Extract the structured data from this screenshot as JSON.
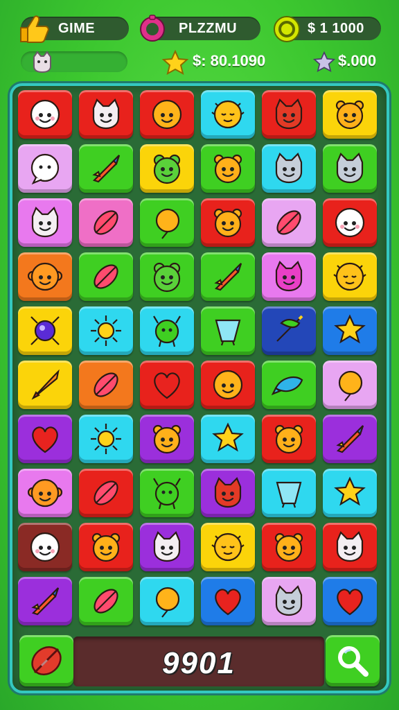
{
  "hud": {
    "game_label": "GIME",
    "puzzle_label": "PLZZMU",
    "coins_label": "$ 1 1000",
    "money_value": "$: 80.1090",
    "star_value": "$.000"
  },
  "score": {
    "value": "9901"
  },
  "colors": {
    "red": "#e8221c",
    "yellow": "#fbd40a",
    "cyan": "#2fd8ef",
    "green": "#3fcf22",
    "pink": "#e879ee",
    "magenta": "#ef6fc6",
    "orange": "#f3781d",
    "purple": "#9b2fdc",
    "blue": "#1f7ce8",
    "navy": "#2347b8",
    "maroon": "#8a2a25",
    "lilac": "#e8a6f2"
  },
  "board": {
    "rows": [
      [
        {
          "c": "red",
          "i": "ghost"
        },
        {
          "c": "red",
          "i": "cat"
        },
        {
          "c": "red",
          "i": "smiley"
        },
        {
          "c": "cyan",
          "i": "sleepy"
        },
        {
          "c": "red",
          "i": "devil-cat"
        },
        {
          "c": "yellow",
          "i": "bear"
        }
      ],
      [
        {
          "c": "lilac",
          "i": "ghost-chat"
        },
        {
          "c": "green",
          "i": "rocket"
        },
        {
          "c": "yellow",
          "i": "frog"
        },
        {
          "c": "green",
          "i": "bear"
        },
        {
          "c": "cyan",
          "i": "cat-gray"
        },
        {
          "c": "green",
          "i": "cat-gray"
        }
      ],
      [
        {
          "c": "pink",
          "i": "cat"
        },
        {
          "c": "magenta",
          "i": "leaf"
        },
        {
          "c": "green",
          "i": "balloon"
        },
        {
          "c": "red",
          "i": "bear"
        },
        {
          "c": "lilac",
          "i": "leaf"
        },
        {
          "c": "red",
          "i": "ghost"
        }
      ],
      [
        {
          "c": "orange",
          "i": "monkey"
        },
        {
          "c": "green",
          "i": "leaf"
        },
        {
          "c": "green",
          "i": "frog"
        },
        {
          "c": "green",
          "i": "rocket"
        },
        {
          "c": "pink",
          "i": "cat-pink"
        },
        {
          "c": "yellow",
          "i": "sleepy"
        }
      ],
      [
        {
          "c": "yellow",
          "i": "orb"
        },
        {
          "c": "cyan",
          "i": "sun"
        },
        {
          "c": "cyan",
          "i": "alien"
        },
        {
          "c": "green",
          "i": "cup"
        },
        {
          "c": "navy",
          "i": "bow"
        },
        {
          "c": "blue",
          "i": "star"
        }
      ],
      [
        {
          "c": "yellow",
          "i": "dart"
        },
        {
          "c": "orange",
          "i": "leaf"
        },
        {
          "c": "red",
          "i": "heart"
        },
        {
          "c": "red",
          "i": "smiley"
        },
        {
          "c": "green",
          "i": "fish"
        },
        {
          "c": "lilac",
          "i": "balloon"
        }
      ],
      [
        {
          "c": "purple",
          "i": "heart"
        },
        {
          "c": "cyan",
          "i": "sun"
        },
        {
          "c": "purple",
          "i": "bear"
        },
        {
          "c": "cyan",
          "i": "star"
        },
        {
          "c": "red",
          "i": "bear"
        },
        {
          "c": "purple",
          "i": "rocket"
        }
      ],
      [
        {
          "c": "pink",
          "i": "monkey"
        },
        {
          "c": "red",
          "i": "leaf"
        },
        {
          "c": "green",
          "i": "alien"
        },
        {
          "c": "purple",
          "i": "devil-cat"
        },
        {
          "c": "cyan",
          "i": "cup"
        },
        {
          "c": "cyan",
          "i": "star"
        }
      ],
      [
        {
          "c": "maroon",
          "i": "ghost"
        },
        {
          "c": "red",
          "i": "bear"
        },
        {
          "c": "purple",
          "i": "cat"
        },
        {
          "c": "yellow",
          "i": "sleepy"
        },
        {
          "c": "red",
          "i": "bear"
        },
        {
          "c": "red",
          "i": "cat"
        }
      ],
      [
        {
          "c": "purple",
          "i": "rocket"
        },
        {
          "c": "green",
          "i": "leaf"
        },
        {
          "c": "cyan",
          "i": "balloon"
        },
        {
          "c": "blue",
          "i": "heart"
        },
        {
          "c": "lilac",
          "i": "cat-gray"
        },
        {
          "c": "blue",
          "i": "heart"
        }
      ]
    ]
  },
  "buttons": {
    "left": {
      "color": "green",
      "icon": "leaf-red"
    },
    "right": {
      "color": "green",
      "icon": "magnifier"
    }
  }
}
